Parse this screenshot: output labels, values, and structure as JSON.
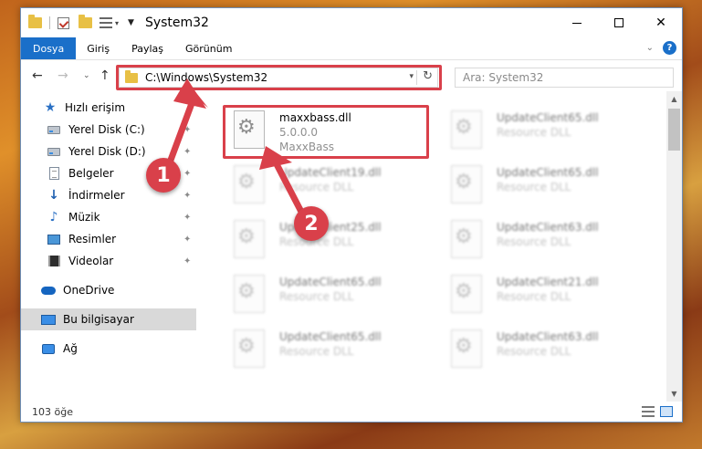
{
  "window": {
    "title": "System32",
    "minimize_icon": "minimize-icon",
    "maximize_icon": "maximize-icon",
    "close_glyph": "✕"
  },
  "ribbon": {
    "tabs": [
      {
        "label": "Dosya"
      },
      {
        "label": "Giriş"
      },
      {
        "label": "Paylaş"
      },
      {
        "label": "Görünüm"
      }
    ],
    "help_glyph": "?"
  },
  "navbar": {
    "back_glyph": "←",
    "forward_glyph": "→",
    "recent_glyph": "⌄",
    "up_glyph": "↑",
    "address": "C:\\Windows\\System32",
    "refresh_glyph": "↻",
    "search_placeholder": "Ara: System32"
  },
  "sidebar": {
    "items": [
      {
        "label": "Hızlı erişim",
        "icon": "quick-access-star-icon"
      },
      {
        "label": "Yerel Disk (C:)",
        "icon": "drive-icon",
        "pinned": true
      },
      {
        "label": "Yerel Disk (D:)",
        "icon": "drive-icon",
        "pinned": true
      },
      {
        "label": "Belgeler",
        "icon": "documents-icon",
        "pinned": true
      },
      {
        "label": "İndirmeler",
        "icon": "downloads-icon",
        "pinned": true
      },
      {
        "label": "Müzik",
        "icon": "music-icon",
        "pinned": true
      },
      {
        "label": "Resimler",
        "icon": "pictures-icon",
        "pinned": true
      },
      {
        "label": "Videolar",
        "icon": "videos-icon",
        "pinned": true
      },
      {
        "label": "OneDrive",
        "icon": "onedrive-icon"
      },
      {
        "label": "Bu bilgisayar",
        "icon": "this-pc-icon",
        "selected": true
      },
      {
        "label": "Ağ",
        "icon": "network-icon"
      }
    ]
  },
  "files": [
    {
      "name": "maxxbass.dll",
      "line2": "5.0.0.0",
      "line3": "MaxxBass"
    },
    {
      "name": "UpdateClient65.dll",
      "line2": "Resource DLL"
    },
    {
      "name": "UpdateClient19.dll",
      "line2": "Resource DLL"
    },
    {
      "name": "UpdateClient65.dll",
      "line2": "Resource DLL"
    },
    {
      "name": "UpdateClient25.dll",
      "line2": "Resource DLL"
    },
    {
      "name": "UpdateClient63.dll",
      "line2": "Resource DLL"
    },
    {
      "name": "UpdateClient65.dll",
      "line2": "Resource DLL"
    },
    {
      "name": "UpdateClient21.dll",
      "line2": "Resource DLL"
    },
    {
      "name": "UpdateClient65.dll",
      "line2": "Resource DLL"
    },
    {
      "name": "UpdateClient63.dll",
      "line2": "Resource DLL"
    }
  ],
  "status": {
    "item_count": "103 öğe"
  },
  "annotations": {
    "step1": "1",
    "step2": "2",
    "color": "#d9404a"
  }
}
